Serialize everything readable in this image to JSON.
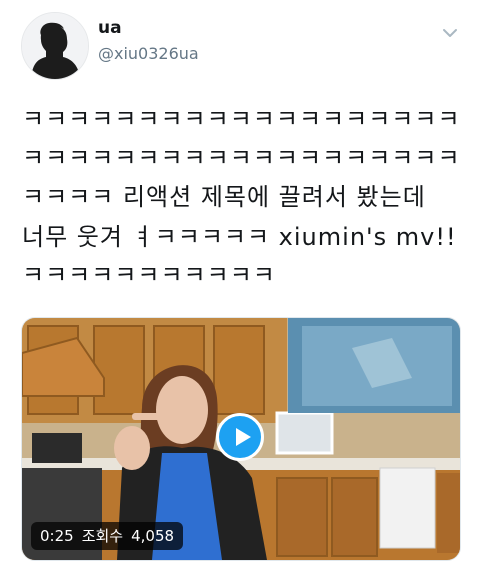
{
  "user": {
    "display_name": "ua",
    "handle": "@xiu0326ua"
  },
  "tweet": {
    "lines": [
      "ㅋㅋㅋㅋㅋㅋㅋㅋㅋㅋㅋㅋㅋㅋㅋㅋㅋㅋㅋ",
      "ㅋㅋㅋㅋㅋㅋㅋㅋㅋㅋㅋㅋㅋㅋㅋㅋㅋㅋㅋ",
      "ㅋㅋㅋㅋ 리액션 제목에 끌려서 봤는데",
      "너무 웃겨 ㅕㅋㅋㅋㅋㅋ xiumin's mv!!",
      "ㅋㅋㅋㅋㅋㅋㅋㅋㅋㅋㅋ"
    ]
  },
  "video": {
    "duration": "0:25",
    "views_label": "조회수",
    "views": "4,058"
  },
  "icons": {
    "menu": "chevron-down-icon",
    "play": "play-icon",
    "avatar": "silhouette-avatar"
  },
  "colors": {
    "accent": "#1da1f2",
    "text": "#14171a",
    "secondary": "#657786"
  }
}
